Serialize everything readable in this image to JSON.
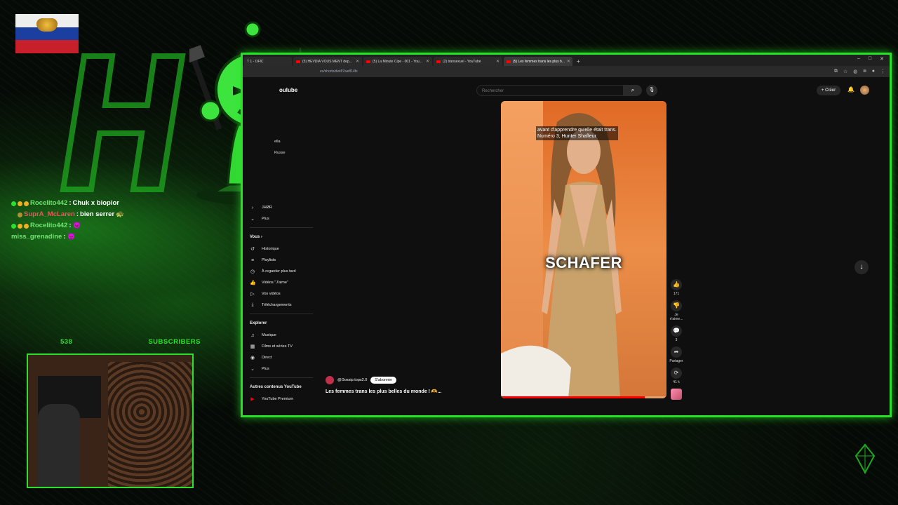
{
  "overlay": {
    "subscriber_count": "538",
    "subscriber_label": "SUBSCRIBERS"
  },
  "chat": [
    {
      "user": "Rocelito442",
      "sep": " : ",
      "message": "Chuk x biopior",
      "user_color": "#6fe46f",
      "emote": ""
    },
    {
      "user": "SuprA_McLaren",
      "sep": " : ",
      "message": "bien serrer",
      "user_color": "#e05a5a",
      "emote": "🐢"
    },
    {
      "user": "Rocelito442",
      "sep": " : ",
      "message": "",
      "user_color": "#6fe46f",
      "emote": "😈"
    },
    {
      "user": "miss_grenadine",
      "sep": " : ",
      "message": "",
      "user_color": "#6fe46f",
      "emote": "😈"
    }
  ],
  "browser": {
    "tabs": [
      {
        "title": "T 1 - OFIC"
      },
      {
        "title": "(5) HEVDIA VOUS MENT dep..."
      },
      {
        "title": "(5) La Minute Cipe - 001 - You..."
      },
      {
        "title": "(2) transexuel - YouTube"
      },
      {
        "title": "(5) Les femmes trans les plus b..."
      }
    ],
    "url": "es/shorts/dwt87we814fs",
    "window_controls": [
      "–",
      "□",
      "✕"
    ]
  },
  "youtube": {
    "logo_fragment": "oulube",
    "search_placeholder": "Rechercher",
    "create_label": "Créer",
    "sidebar_fragments": [
      "ella",
      "Russe"
    ],
    "sidebar": {
      "top_items": [
        {
          "icon": "›",
          "label": "JHØR",
          "icon_name": "chevron-right-icon"
        },
        {
          "icon": "⌄",
          "label": "Plus",
          "icon_name": "chevron-down-icon"
        }
      ],
      "you_heading": "Vous",
      "you_items": [
        {
          "icon": "↺",
          "label": "Historique",
          "icon_name": "history-icon"
        },
        {
          "icon": "≡",
          "label": "Playlists",
          "icon_name": "playlist-icon"
        },
        {
          "icon": "◷",
          "label": "À regarder plus tard",
          "icon_name": "clock-icon"
        },
        {
          "icon": "👍",
          "label": "Vidéos \"J'aime\"",
          "icon_name": "like-icon"
        },
        {
          "icon": "▷",
          "label": "Vos vidéos",
          "icon_name": "video-icon"
        },
        {
          "icon": "⤓",
          "label": "Téléchargements",
          "icon_name": "download-icon"
        }
      ],
      "explore_heading": "Explorer",
      "explore_items": [
        {
          "icon": "♫",
          "label": "Musique",
          "icon_name": "music-icon"
        },
        {
          "icon": "▦",
          "label": "Films et séries TV",
          "icon_name": "film-icon"
        },
        {
          "icon": "◉",
          "label": "Direct",
          "icon_name": "live-icon"
        },
        {
          "icon": "⌄",
          "label": "Plus",
          "icon_name": "chevron-down-icon"
        }
      ],
      "other_heading": "Autres contenus YouTube",
      "other_items": [
        {
          "icon": "▶",
          "label": "YouTube Premium",
          "icon_name": "youtube-premium-icon"
        }
      ]
    },
    "short": {
      "caption_line1": "avant d'apprendre qu'elle était trans.",
      "caption_line2": "Numéro 3, Hunter Shaffeur",
      "big_text": "SCHAFER",
      "channel": "@Gossip.tops2.0",
      "subscribe_label": "S'abonner",
      "title": "Les femmes trans les plus belles du monde ! 🫶...",
      "progress": 0.87
    },
    "actions": [
      {
        "icon": "👍",
        "label": "171",
        "icon_name": "like-icon"
      },
      {
        "icon": "👎",
        "label": "Je n'aime...",
        "icon_name": "dislike-icon"
      },
      {
        "icon": "💬",
        "label": "3",
        "icon_name": "comment-icon"
      },
      {
        "icon": "➦",
        "label": "Partager",
        "icon_name": "share-icon"
      },
      {
        "icon": "⟳",
        "label": "41 k",
        "icon_name": "remix-icon"
      }
    ]
  }
}
